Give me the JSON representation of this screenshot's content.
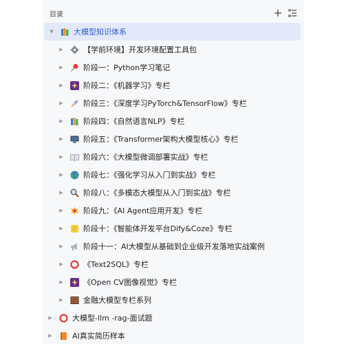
{
  "header": {
    "title": "目录",
    "add_icon": "plus-icon",
    "menu_icon": "list-menu-icon"
  },
  "tree": {
    "root": {
      "label": "大模型知识体系",
      "icon": "books-icon",
      "expanded": true
    },
    "children": [
      {
        "label": "【学前环境】开发环境配置工具包",
        "icon": "gear-icon"
      },
      {
        "label": "阶段一：Python学习笔记",
        "icon": "pushpin-icon"
      },
      {
        "label": "阶段二：《机器学习》专栏",
        "icon": "sparkle-icon"
      },
      {
        "label": "阶段三：《深度学习PyTorch&TensorFlow》专栏",
        "icon": "rocket-icon"
      },
      {
        "label": "阶段四：《自然语言NLP》专栏",
        "icon": "books-icon"
      },
      {
        "label": "阶段五：《Transformer架构大模型核心》专栏",
        "icon": "monitor-icon"
      },
      {
        "label": "阶段六：《大模型微调部署实战》专栏",
        "icon": "open-book-icon"
      },
      {
        "label": "阶段七：《强化学习从入门到实战》专栏",
        "icon": "globe-icon"
      },
      {
        "label": "阶段八：《多模态大模型从入门到实战》专栏",
        "icon": "magnifier-icon"
      },
      {
        "label": "阶段九：《AI Agent应用开发》专栏",
        "icon": "burst-icon"
      },
      {
        "label": "阶段十：《智能体开发平台Dify&Coze》专栏",
        "icon": "note-icon"
      },
      {
        "label": "阶段十一：AI大模型从基础到企业级开发落地实战案例",
        "icon": "megaphone-icon"
      },
      {
        "label": "《Text2SQL》专栏",
        "icon": "red-circle-icon"
      },
      {
        "label": "《Open CV图像视觉》专栏",
        "icon": "sparkle-icon"
      },
      {
        "label": "金融大模型专栏系列",
        "icon": "bricks-icon"
      }
    ],
    "siblings": [
      {
        "label": "大模型-llm -rag-面试题",
        "icon": "red-circle-icon"
      },
      {
        "label": "AI真实简历样本",
        "icon": "orange-book-icon"
      }
    ]
  }
}
